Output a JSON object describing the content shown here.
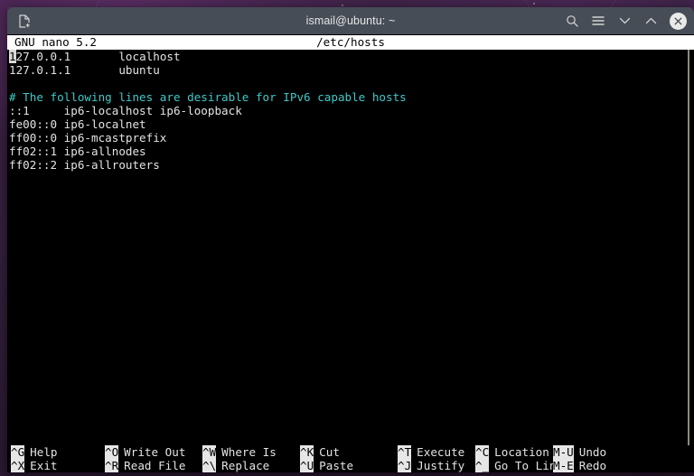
{
  "window": {
    "title": "ismail@ubuntu: ~",
    "titlebar_icons": [
      {
        "name": "new-tab-icon",
        "glyph": "new-tab"
      },
      {
        "name": "search-icon",
        "glyph": "search"
      },
      {
        "name": "hamburger-menu-icon",
        "glyph": "menu"
      },
      {
        "name": "chevron-down-icon",
        "glyph": "chevron-down"
      },
      {
        "name": "chevron-up-icon",
        "glyph": "chevron-up"
      },
      {
        "name": "close-icon",
        "glyph": "close"
      }
    ],
    "colors": {
      "titlebar_bg": "#474d57",
      "titlebar_fg": "#e6e6e6",
      "terminal_bg": "#000000",
      "terminal_fg": "#e3e3e3",
      "comment_fg": "#3fc9c9",
      "inverse_bg": "#ffffff",
      "inverse_fg": "#000000",
      "desktop_bg": "#33203d"
    }
  },
  "nano": {
    "version": "GNU nano 5.2",
    "filename": "/etc/hosts",
    "lines": [
      {
        "text": "127.0.0.1       localhost",
        "style": "normal",
        "cursor_col": 0
      },
      {
        "text": "127.0.1.1       ubuntu",
        "style": "normal"
      },
      {
        "text": "",
        "style": "blank"
      },
      {
        "text": "# The following lines are desirable for IPv6 capable hosts",
        "style": "comment"
      },
      {
        "text": "::1     ip6-localhost ip6-loopback",
        "style": "normal"
      },
      {
        "text": "fe00::0 ip6-localnet",
        "style": "normal"
      },
      {
        "text": "ff00::0 ip6-mcastprefix",
        "style": "normal"
      },
      {
        "text": "ff02::1 ip6-allnodes",
        "style": "normal"
      },
      {
        "text": "ff02::2 ip6-allrouters",
        "style": "normal"
      }
    ],
    "shortcuts_row1": [
      {
        "key": "^G",
        "label": "Help"
      },
      {
        "key": "^O",
        "label": "Write Out"
      },
      {
        "key": "^W",
        "label": "Where Is"
      },
      {
        "key": "^K",
        "label": "Cut"
      },
      {
        "key": "^T",
        "label": "Execute"
      },
      {
        "key": "^C",
        "label": "Location"
      },
      {
        "key": "M-U",
        "label": "Undo"
      }
    ],
    "shortcuts_row2": [
      {
        "key": "^X",
        "label": "Exit"
      },
      {
        "key": "^R",
        "label": "Read File"
      },
      {
        "key": "^\\",
        "label": "Replace"
      },
      {
        "key": "^U",
        "label": "Paste"
      },
      {
        "key": "^J",
        "label": "Justify"
      },
      {
        "key": "^_",
        "label": "Go To Line"
      },
      {
        "key": "M-E",
        "label": "Redo"
      }
    ]
  }
}
